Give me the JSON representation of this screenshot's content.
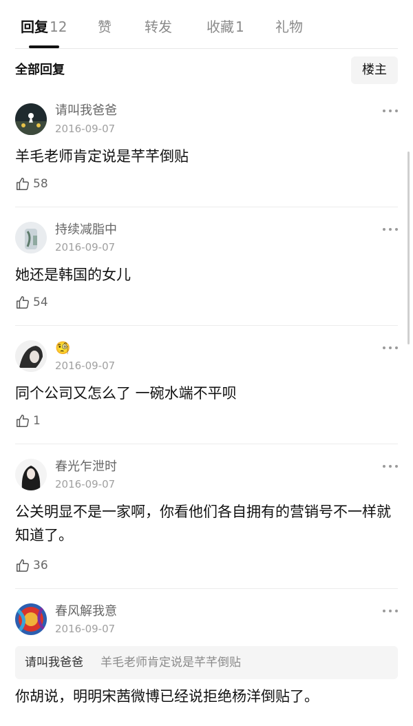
{
  "tabs": [
    {
      "label": "回复",
      "count": "12",
      "active": true
    },
    {
      "label": "赞",
      "count": ""
    },
    {
      "label": "转发",
      "count": ""
    },
    {
      "label": "收藏",
      "count": "1"
    },
    {
      "label": "礼物",
      "count": ""
    }
  ],
  "section": {
    "title": "全部回复",
    "filter_label": "楼主"
  },
  "comments": [
    {
      "username": "请叫我爸爸",
      "date": "2016-09-07",
      "text": "羊毛老师肯定说是芊芊倒贴",
      "likes": "58"
    },
    {
      "username": "持续减脂中",
      "date": "2016-09-07",
      "text": "她还是韩国的女儿",
      "likes": "54"
    },
    {
      "username": "",
      "username_emoji": "🧐",
      "date": "2016-09-07",
      "text": "同个公司又怎么了 一碗水端不平呗",
      "likes": "1"
    },
    {
      "username": "春光乍泄时",
      "date": "2016-09-07",
      "text": "公关明显不是一家啊，你看他们各自拥有的营销号不一样就知道了。",
      "likes": "36"
    },
    {
      "username": "春风解我意",
      "date": "2016-09-07",
      "quote_user": "请叫我爸爸",
      "quote_text": "羊毛老师肯定说是芊芊倒贴",
      "text": "你胡说，明明宋茜微博已经说拒绝杨洋倒贴了。"
    }
  ],
  "icons": {
    "more": "more-dots-icon",
    "like": "thumbs-up-icon",
    "avatar": "user-avatar"
  }
}
